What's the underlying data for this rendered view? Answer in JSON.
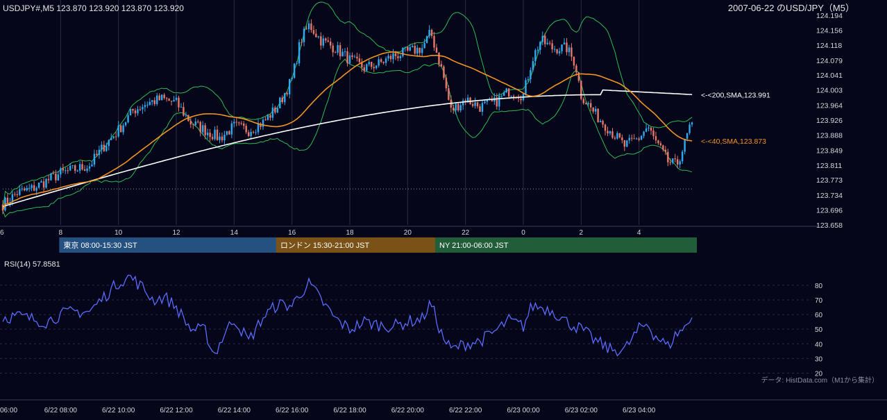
{
  "header": {
    "symbol_info": "USDJPY#,M5 123.870 123.920 123.870 123.920",
    "date_title": "2007-06-22 のUSD/JPY（M5）"
  },
  "chart_data": [
    {
      "type": "candlestick",
      "name": "price",
      "ylim": [
        123.658,
        124.194
      ],
      "y_ticks": [
        124.194,
        124.156,
        124.118,
        124.079,
        124.041,
        124.003,
        123.964,
        123.926,
        123.888,
        123.849,
        123.811,
        123.773,
        123.734,
        123.696,
        123.658
      ],
      "x_range_hours": [
        6,
        30
      ],
      "x_tick_labels": [
        "6",
        "8",
        "10",
        "12",
        "14",
        "16",
        "18",
        "20",
        "22",
        "0",
        "2",
        "4"
      ],
      "x_tick_hours": [
        6,
        8,
        10,
        12,
        14,
        16,
        18,
        20,
        22,
        24,
        26,
        28
      ],
      "key_close": [
        [
          6.0,
          123.71
        ],
        [
          6.5,
          123.74
        ],
        [
          7.0,
          123.75
        ],
        [
          7.5,
          123.77
        ],
        [
          8.0,
          123.79
        ],
        [
          8.5,
          123.8
        ],
        [
          9.0,
          123.81
        ],
        [
          9.5,
          123.86
        ],
        [
          10.0,
          123.9
        ],
        [
          10.5,
          123.95
        ],
        [
          11.0,
          123.97
        ],
        [
          11.5,
          123.98
        ],
        [
          12.0,
          123.97
        ],
        [
          12.5,
          123.92
        ],
        [
          13.0,
          123.9
        ],
        [
          13.5,
          123.88
        ],
        [
          14.0,
          123.91
        ],
        [
          14.5,
          123.9
        ],
        [
          15.0,
          123.92
        ],
        [
          15.5,
          123.96
        ],
        [
          16.0,
          124.03
        ],
        [
          16.3,
          124.13
        ],
        [
          16.6,
          124.17
        ],
        [
          17.0,
          124.13
        ],
        [
          17.5,
          124.11
        ],
        [
          18.0,
          124.08
        ],
        [
          18.5,
          124.06
        ],
        [
          19.0,
          124.07
        ],
        [
          19.5,
          124.09
        ],
        [
          20.0,
          124.1
        ],
        [
          20.5,
          124.11
        ],
        [
          20.8,
          124.15
        ],
        [
          21.2,
          124.05
        ],
        [
          21.5,
          123.95
        ],
        [
          22.0,
          123.98
        ],
        [
          22.5,
          123.96
        ],
        [
          23.0,
          123.97
        ],
        [
          23.5,
          124.0
        ],
        [
          24.0,
          123.99
        ],
        [
          24.3,
          124.08
        ],
        [
          24.6,
          124.13
        ],
        [
          25.0,
          124.11
        ],
        [
          25.5,
          124.11
        ],
        [
          25.8,
          124.07
        ],
        [
          26.0,
          123.99
        ],
        [
          26.5,
          123.94
        ],
        [
          27.0,
          123.9
        ],
        [
          27.5,
          123.86
        ],
        [
          28.0,
          123.88
        ],
        [
          28.3,
          123.91
        ],
        [
          28.5,
          123.88
        ],
        [
          29.0,
          123.82
        ],
        [
          29.3,
          123.81
        ],
        [
          29.6,
          123.87
        ],
        [
          29.8,
          123.92
        ]
      ],
      "close": 123.92,
      "indicators": [
        {
          "name": "200,SMA",
          "value": 123.991,
          "label": "<-<200,SMA,123.991",
          "color": "#ffffff"
        },
        {
          "name": "40,SMA",
          "value": 123.873,
          "label": "<-<40,SMA,123.873",
          "color": "#f29424"
        }
      ],
      "bollinger_bands": true,
      "bb_color": "#2dbc52",
      "up_color": "#2eaaf0",
      "down_color": "#e8776a",
      "reference_dotted_line": 123.75,
      "grid": "vertical"
    },
    {
      "type": "line",
      "name": "RSI",
      "title": "RSI(14) 57.8581",
      "ylim": [
        15,
        88
      ],
      "y_ticks": [
        80,
        70,
        60,
        50,
        40,
        30,
        20
      ],
      "key_values": [
        [
          6.0,
          58
        ],
        [
          6.5,
          59
        ],
        [
          7.0,
          57
        ],
        [
          7.5,
          55
        ],
        [
          8.0,
          60
        ],
        [
          8.5,
          62
        ],
        [
          9.0,
          62
        ],
        [
          9.5,
          72
        ],
        [
          10.0,
          82
        ],
        [
          10.4,
          86
        ],
        [
          10.8,
          79
        ],
        [
          11.2,
          70
        ],
        [
          11.6,
          72
        ],
        [
          12.0,
          65
        ],
        [
          12.5,
          50
        ],
        [
          13.0,
          49
        ],
        [
          13.3,
          32
        ],
        [
          13.7,
          48
        ],
        [
          14.0,
          57
        ],
        [
          14.5,
          42
        ],
        [
          15.0,
          58
        ],
        [
          15.5,
          67
        ],
        [
          16.0,
          66
        ],
        [
          16.3,
          75
        ],
        [
          16.6,
          81
        ],
        [
          17.0,
          70
        ],
        [
          17.5,
          57
        ],
        [
          18.0,
          50
        ],
        [
          18.5,
          55
        ],
        [
          19.0,
          53
        ],
        [
          19.5,
          52
        ],
        [
          20.0,
          55
        ],
        [
          20.5,
          57
        ],
        [
          20.8,
          68
        ],
        [
          21.2,
          45
        ],
        [
          21.5,
          36
        ],
        [
          22.0,
          40
        ],
        [
          22.5,
          42
        ],
        [
          23.0,
          48
        ],
        [
          23.5,
          56
        ],
        [
          24.0,
          52
        ],
        [
          24.3,
          66
        ],
        [
          24.6,
          65
        ],
        [
          25.0,
          63
        ],
        [
          25.5,
          55
        ],
        [
          26.0,
          50
        ],
        [
          26.5,
          42
        ],
        [
          27.0,
          36
        ],
        [
          27.5,
          36
        ],
        [
          28.0,
          50
        ],
        [
          28.3,
          54
        ],
        [
          28.5,
          47
        ],
        [
          29.0,
          38
        ],
        [
          29.3,
          47
        ],
        [
          29.6,
          51
        ],
        [
          29.8,
          57.9
        ]
      ],
      "line_color": "#5b6bff"
    }
  ],
  "sessions": [
    {
      "label": "東京 08:00-15:30 JST",
      "start_hour": 8,
      "end_hour": 15.5,
      "color": "#24517f"
    },
    {
      "label": "ロンドン 15:30-21:00 JST",
      "start_hour": 15.5,
      "end_hour": 21,
      "color": "#7a5116"
    },
    {
      "label": "NY 21:00-06:00 JST",
      "start_hour": 21,
      "end_hour": 30,
      "color": "#225d3a"
    }
  ],
  "source": "データ: HistData.com（M1から集計）",
  "x_axis": {
    "labels": [
      "06:00",
      "6/22 08:00",
      "6/22 10:00",
      "6/22 12:00",
      "6/22 14:00",
      "6/22 16:00",
      "6/22 18:00",
      "6/22 20:00",
      "6/22 22:00",
      "6/23 00:00",
      "6/23 02:00",
      "6/23 04:00"
    ],
    "hours": [
      6,
      8,
      10,
      12,
      14,
      16,
      18,
      20,
      22,
      24,
      26,
      28
    ]
  }
}
